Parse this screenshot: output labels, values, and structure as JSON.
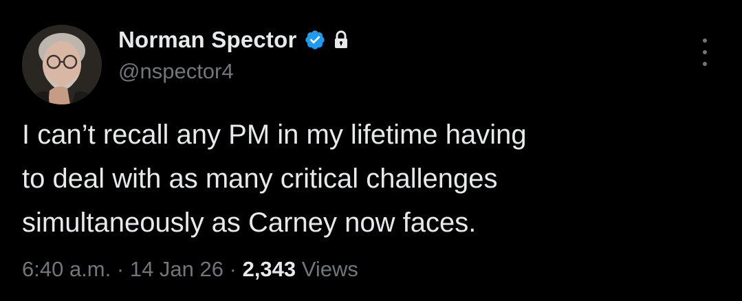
{
  "author": {
    "display_name": "Norman Spector",
    "handle": "@nspector4",
    "verified_icon": "verified-badge-icon",
    "lock_icon": "lock-icon",
    "avatar": "avatar"
  },
  "tweet": {
    "text_lines": [
      "I can’t recall any PM in my lifetime having",
      "to deal with as many critical challenges",
      "simultaneously as Carney now faces."
    ]
  },
  "meta": {
    "time": "6:40 a.m.",
    "separator": "·",
    "date": "14 Jan 26",
    "views_count": "2,343",
    "views_label": "Views"
  },
  "menu": {
    "more_icon": "more-options-icon"
  },
  "colors": {
    "background": "#000000",
    "primary_text": "#e7e9ea",
    "secondary_text": "#71767b",
    "verified_blue": "#1d9bf0"
  }
}
